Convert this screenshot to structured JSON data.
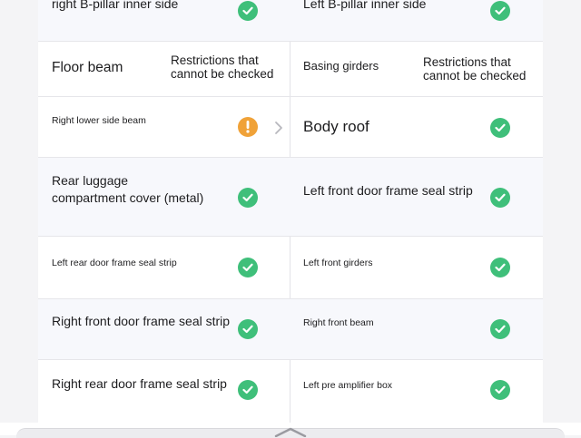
{
  "rows": [
    {
      "left": {
        "label": "right B-pillar inner side",
        "status": "ok"
      },
      "right": {
        "label": "Left B-pillar inner side",
        "status": "ok"
      }
    },
    {
      "left": {
        "label": "Floor beam",
        "note": "Restrictions that cannot be checked"
      },
      "right": {
        "label": "Basing girders",
        "note": "Restrictions that cannot be checked"
      }
    },
    {
      "left": {
        "label": "Right lower side beam",
        "status": "warning"
      },
      "right": {
        "label": "Body roof",
        "status": "ok"
      }
    },
    {
      "left": {
        "label": "Rear luggage compartment cover (metal)",
        "line1": "Rear luggage",
        "line2": "compartment cover (metal)",
        "status": "ok"
      },
      "right": {
        "label": "Left front door frame seal strip",
        "status": "ok"
      }
    },
    {
      "left": {
        "label": "Left rear door frame seal strip",
        "status": "ok"
      },
      "right": {
        "label": "Left front girders",
        "status": "ok"
      }
    },
    {
      "left": {
        "label": "Right front door frame seal strip",
        "status": "ok"
      },
      "right": {
        "label": "Right front beam",
        "status": "ok"
      }
    },
    {
      "left": {
        "label": "Right rear door frame seal strip",
        "status": "ok"
      },
      "right": {
        "label": "Left pre amplifier box",
        "status": "ok"
      }
    }
  ],
  "icons": {
    "ok": "check-circle-icon",
    "warning": "exclamation-circle-icon",
    "chevron": "chevron-right-icon"
  },
  "colors": {
    "ok": "#3fbf7a",
    "warning": "#f0a238",
    "divider": "#e3e3e8"
  }
}
